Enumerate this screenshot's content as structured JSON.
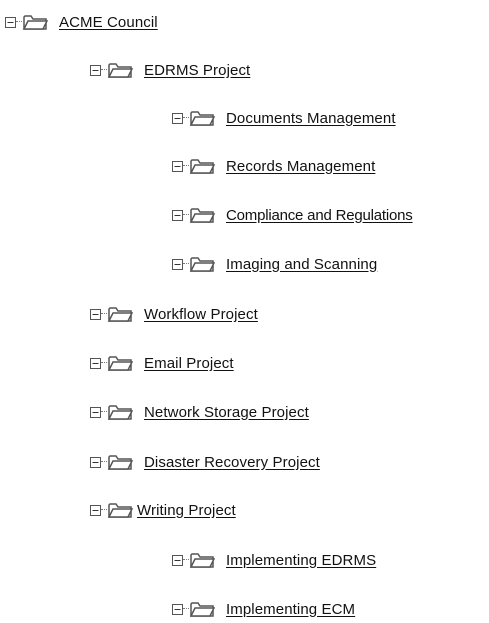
{
  "tree": {
    "nodes": [
      {
        "label": "ACME Council",
        "expander_state": "expanded",
        "icon": "folder-open-icon"
      },
      {
        "label": "EDRMS Project",
        "expander_state": "expanded",
        "icon": "folder-open-icon"
      },
      {
        "label": "Documents Management",
        "expander_state": "expanded",
        "icon": "folder-open-icon"
      },
      {
        "label": "Records Management",
        "expander_state": "expanded",
        "icon": "folder-open-icon"
      },
      {
        "label": "Compliance and Regulations",
        "expander_state": "expanded",
        "icon": "folder-open-icon"
      },
      {
        "label": "Imaging and Scanning",
        "expander_state": "expanded",
        "icon": "folder-open-icon"
      },
      {
        "label": "Workflow Project",
        "expander_state": "expanded",
        "icon": "folder-open-icon"
      },
      {
        "label": "Email Project",
        "expander_state": "expanded",
        "icon": "folder-open-icon"
      },
      {
        "label": "Network Storage Project",
        "expander_state": "expanded",
        "icon": "folder-open-icon"
      },
      {
        "label": "Disaster Recovery Project",
        "expander_state": "expanded",
        "icon": "folder-open-icon"
      },
      {
        "label": "Writing Project",
        "expander_state": "expanded",
        "icon": "folder-open-icon"
      },
      {
        "label": "Implementing EDRMS",
        "expander_state": "expanded",
        "icon": "folder-open-icon"
      },
      {
        "label": "Implementing ECM",
        "expander_state": "expanded",
        "icon": "folder-open-icon"
      }
    ]
  },
  "colors": {
    "text": "#111111",
    "icon_stroke": "#555555",
    "folder_fill": "#ffffff"
  }
}
